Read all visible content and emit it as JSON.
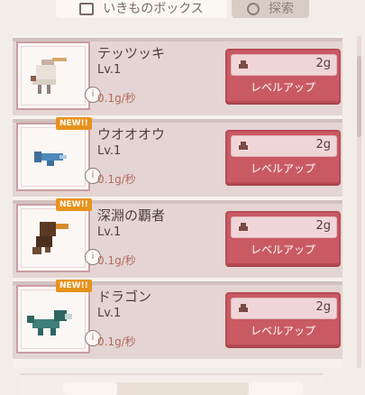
{
  "tabs": [
    {
      "label": "いきものボックス",
      "icon": "box-icon",
      "active": true
    },
    {
      "label": "探索",
      "icon": "search-icon",
      "active": false
    }
  ],
  "creatures": [
    {
      "name": "テッツッキ",
      "level": "Lv.1",
      "rate": "0.1g/秒",
      "cost": "2g",
      "button": "レベルアップ",
      "new": false,
      "icon": "woodpecker-icon"
    },
    {
      "name": "ウオオオウ",
      "level": "Lv.1",
      "rate": "0.1g/秒",
      "cost": "2g",
      "button": "レベルアップ",
      "new": true,
      "badge": "NEW!!",
      "icon": "fish-icon"
    },
    {
      "name": "深淵の覇者",
      "level": "Lv.1",
      "rate": "0.1g/秒",
      "cost": "2g",
      "button": "レベルアップ",
      "new": true,
      "badge": "NEW!!",
      "icon": "toucan-icon"
    },
    {
      "name": "ドラゴン",
      "level": "Lv.1",
      "rate": "0.1g/秒",
      "cost": "2g",
      "button": "レベルアップ",
      "new": true,
      "badge": "NEW!!",
      "icon": "dragon-icon"
    }
  ],
  "colors": {
    "accent": "#c95a63",
    "badge": "#e8921c"
  }
}
